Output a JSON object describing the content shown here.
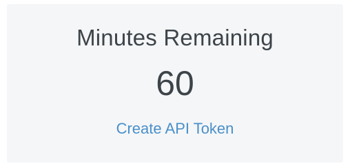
{
  "card": {
    "title": "Minutes Remaining",
    "value": "60",
    "link_label": "Create API Token",
    "link_color": "#4a90c8",
    "text_color": "#3d4449",
    "background": "#f5f6f8"
  }
}
